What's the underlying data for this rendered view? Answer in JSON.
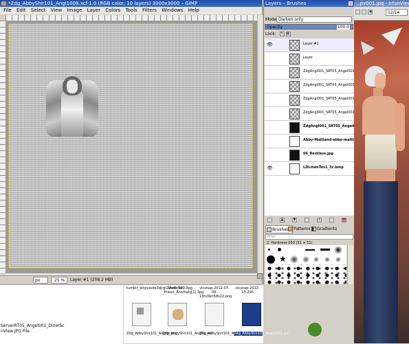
{
  "gimp": {
    "title": "*Zdg_AbbyShir101_Angl1008.xcf-1.0 (RGB color, 10 layers) 3000x3000 – GIMP",
    "menus": [
      "File",
      "Edit",
      "Select",
      "View",
      "Image",
      "Layer",
      "Colors",
      "Tools",
      "Filters",
      "Windows",
      "Help"
    ],
    "unit": "px",
    "zoom": "25 %",
    "status": "Layer #1 (208.2 MB)"
  },
  "layers_panel": {
    "title": "Layers – Brushes",
    "mode_label": "Mode:",
    "mode_value": "Darken only",
    "opacity_label": "Opacity",
    "opacity_value": "100.0",
    "lock_label": "Lock:",
    "layers": [
      {
        "name": "Layer #1",
        "visible": true,
        "thumb": "checker",
        "bold": false
      },
      {
        "name": "Layer",
        "visible": false,
        "thumb": "checker",
        "bold": false
      },
      {
        "name": "ZdgAngl001_SRT05_Angel001.p",
        "visible": false,
        "thumb": "checker",
        "bold": false
      },
      {
        "name": "ZdgAngl001_SRT05_Angel001.p",
        "visible": false,
        "thumb": "checker",
        "bold": false
      },
      {
        "name": "ZdgAngl001_SRT05_Angel001.p",
        "visible": false,
        "thumb": "checker",
        "bold": false
      },
      {
        "name": "ZdgAngl001_SRT05_Angel001.p",
        "visible": false,
        "thumb": "checker",
        "bold": false
      },
      {
        "name": "ZdgAngl001_SRT05_Angel001.",
        "visible": false,
        "thumb": "dark",
        "bold": true
      },
      {
        "name": "Abby-Maitland-abby-maitland",
        "visible": false,
        "thumb": "white",
        "bold": true
      },
      {
        "name": "06_Restless.jpg",
        "visible": false,
        "thumb": "dark",
        "bold": true
      },
      {
        "name": "LDLinenTex1_3c.bmp",
        "visible": true,
        "thumb": "white",
        "bold": true
      }
    ],
    "tabs": [
      "Brushes",
      "Patterns",
      "Gradients"
    ],
    "filter_label": "filter",
    "brush_name": "2. Hardness 050 (51 × 51)"
  },
  "irfanview": {
    "title": "...pv001.jpg - IrfanView (Zoom",
    "page_counter": "12/14"
  },
  "explorer": {
    "files_top": [
      {
        "name": "tumblr_whpyaote3qlrgl2zko0_500.3pg"
      },
      {
        "name": "Victorian_-_Prison_Anomaly[1].3pg"
      },
      {
        "name": "vlcsnap-2012-07-08-13h26m58s22.png"
      },
      {
        "name": "vlcsnap-2012-13-29h"
      }
    ],
    "files_bottom": [
      {
        "name": "Zdg_AbbyShir101_Angl1t.png"
      },
      {
        "name": "Zdg_AbbyShir101_Angl1t.xcf"
      },
      {
        "name": "Zdg_AbbyShir101_Angl1002.png"
      },
      {
        "name": "Zdg_AbbyShir101_Angl1002.xcf"
      }
    ],
    "left_text_1": "ServerRT05_Angel001_DinerSc",
    "left_text_2": "nView JPG File"
  }
}
